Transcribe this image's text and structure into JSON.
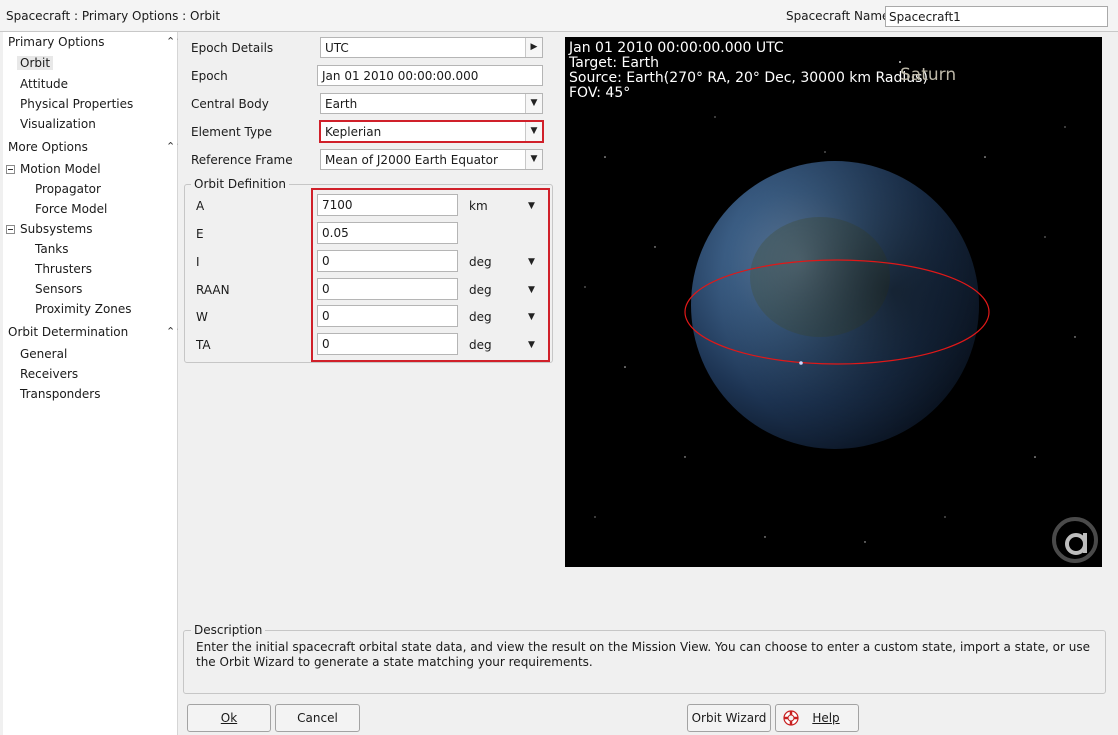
{
  "titlebar": {
    "path": "Spacecraft : Primary Options : Orbit",
    "name_label": "Spacecraft Name",
    "name_value": "Spacecraft1"
  },
  "sidebar": {
    "primary_header": "Primary Options",
    "primary_items": [
      "Orbit",
      "Attitude",
      "Physical Properties",
      "Visualization"
    ],
    "more_header": "More Options",
    "motion_model": "Motion Model",
    "motion_children": [
      "Propagator",
      "Force Model"
    ],
    "subsystems": "Subsystems",
    "subsystem_children": [
      "Tanks",
      "Thrusters",
      "Sensors",
      "Proximity Zones"
    ],
    "od_header": "Orbit Determination",
    "od_items": [
      "General",
      "Receivers",
      "Transponders"
    ]
  },
  "form": {
    "epoch_details_label": "Epoch Details",
    "epoch_details_value": "UTC",
    "epoch_label": "Epoch",
    "epoch_value": "Jan 01 2010 00:00:00.000",
    "central_body_label": "Central Body",
    "central_body_value": "Earth",
    "element_type_label": "Element Type",
    "element_type_value": "Keplerian",
    "reference_frame_label": "Reference Frame",
    "reference_frame_value": "Mean of J2000 Earth Equator"
  },
  "orbit_definition": {
    "legend": "Orbit Definition",
    "rows": [
      {
        "label": "A",
        "value": "7100",
        "unit": "km"
      },
      {
        "label": "E",
        "value": "0.05",
        "unit": ""
      },
      {
        "label": "I",
        "value": "0",
        "unit": "deg"
      },
      {
        "label": "RAAN",
        "value": "0",
        "unit": "deg"
      },
      {
        "label": "W",
        "value": "0",
        "unit": "deg"
      },
      {
        "label": "TA",
        "value": "0",
        "unit": "deg"
      }
    ]
  },
  "view": {
    "line1": "Jan 01 2010 00:00:00.000 UTC",
    "line2": "Target: Earth",
    "line3": "Source: Earth(270° RA, 20° Dec, 30000 km Radius)",
    "line4": "FOV: 45°",
    "planet_label": "Saturn",
    "orbit_color": "#e01818"
  },
  "description": {
    "legend": "Description",
    "text": "Enter the initial spacecraft orbital state data, and view the result on the Mission View. You can choose to enter a custom state, import a state, or use the Orbit Wizard to generate a state matching your requirements."
  },
  "buttons": {
    "ok": "Ok",
    "cancel": "Cancel",
    "orbit_wizard": "Orbit Wizard",
    "help": "Help"
  },
  "colors": {
    "highlight_red": "#d0202a",
    "selected_bg": "#e8e8e8"
  }
}
